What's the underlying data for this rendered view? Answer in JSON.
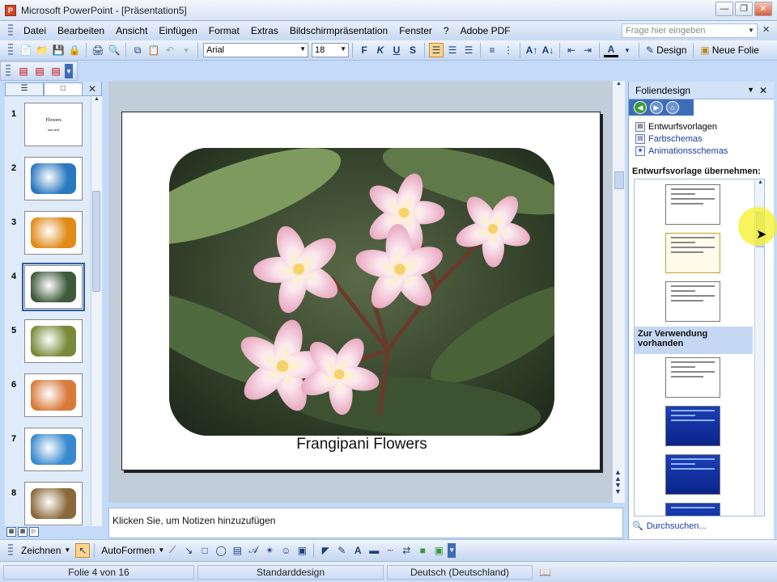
{
  "window": {
    "title": "Microsoft PowerPoint - [Präsentation5]",
    "app_icon": "P"
  },
  "menu": {
    "items": [
      "Datei",
      "Bearbeiten",
      "Ansicht",
      "Einfügen",
      "Format",
      "Extras",
      "Bildschirmpräsentation",
      "Fenster",
      "?",
      "Adobe PDF"
    ],
    "ask_placeholder": "Frage hier eingeben"
  },
  "format": {
    "font": "Arial",
    "size": "18",
    "design_label": "Design",
    "new_slide_label": "Neue Folie"
  },
  "left_panel": {
    "tabs": [
      "outline",
      "slides"
    ],
    "slides": [
      {
        "num": "1",
        "title_text": "Flowers",
        "sub_text": "nav text",
        "color": "#ffffff"
      },
      {
        "num": "2",
        "color": "#2a78c0"
      },
      {
        "num": "3",
        "color": "#e08a18"
      },
      {
        "num": "4",
        "color": "#3d5a3a",
        "selected": true
      },
      {
        "num": "5",
        "color": "#7a8a3a"
      },
      {
        "num": "6",
        "color": "#d87a3a"
      },
      {
        "num": "7",
        "color": "#3a8ad0"
      },
      {
        "num": "8",
        "color": "#8a6a3a"
      }
    ]
  },
  "slide": {
    "caption": "Frangipani Flowers"
  },
  "notes": {
    "placeholder": "Klicken Sie, um Notizen hinzuzufügen"
  },
  "task_pane": {
    "title": "Foliendesign",
    "links": [
      "Entwurfsvorlagen",
      "Farbschemas",
      "Animationsschemas"
    ],
    "apply_heading": "Entwurfsvorlage übernehmen:",
    "available_heading": "Zur Verwendung vorhanden",
    "browse": "Durchsuchen..."
  },
  "drawing": {
    "draw_label": "Zeichnen",
    "autoshapes_label": "AutoFormen"
  },
  "status": {
    "slide_pos": "Folie 4 von 16",
    "design": "Standarddesign",
    "language": "Deutsch (Deutschland)"
  }
}
